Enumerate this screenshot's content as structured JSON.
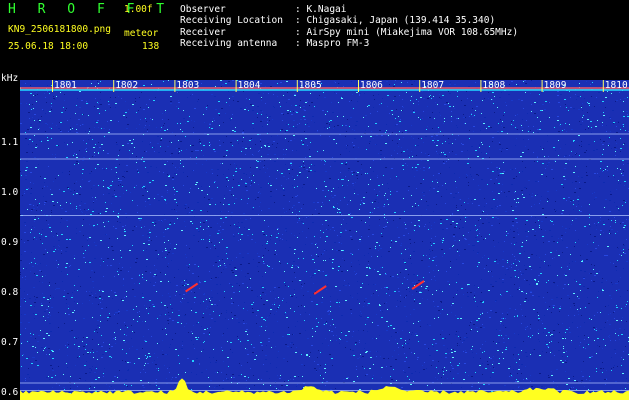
{
  "header": {
    "brand": "H R O F F T",
    "version": "1.00f",
    "filename": "KN9_2506181800.png",
    "mode": "meteor",
    "datetime": "25.06.18 18:00",
    "count": "138",
    "observer_label": "Observer",
    "observer_value": ": K.Nagai",
    "location_label": "Receiving Location",
    "location_value": ": Chigasaki, Japan (139.414 35.340)",
    "receiver_label": "Receiver",
    "receiver_value": ": AirSpy mini (Miakejima VOR 108.65MHz)",
    "antenna_label": "Receiving antenna",
    "antenna_value": ": Maspro FM-3"
  },
  "colors": {
    "background": "#000000",
    "spectrum_base": "#1a2fb4",
    "noise_cyan": "#20d0ff",
    "signal_yellow": "#ffff20",
    "meteor_red": "#ff3030",
    "gridline": "#b0c4ff"
  },
  "chart_data": {
    "type": "heatmap",
    "ylabel": "kHz",
    "y_ticks": [
      "1.1",
      "1.0",
      "0.9",
      "0.8",
      "0.7",
      "0.6"
    ],
    "ylim": [
      0.585,
      1.225
    ],
    "time_labels": [
      "1801",
      "1802",
      "1803",
      "1804",
      "1805",
      "1806",
      "1807",
      "1808",
      "1809",
      "1810"
    ],
    "carrier_lines_khz": [
      1.118,
      1.068,
      0.955,
      0.62,
      0.605
    ],
    "meteor_echoes": [
      {
        "minute": 3.2,
        "khz": 0.81
      },
      {
        "minute": 5.3,
        "khz": 0.805
      },
      {
        "minute": 6.9,
        "khz": 0.815
      }
    ]
  }
}
